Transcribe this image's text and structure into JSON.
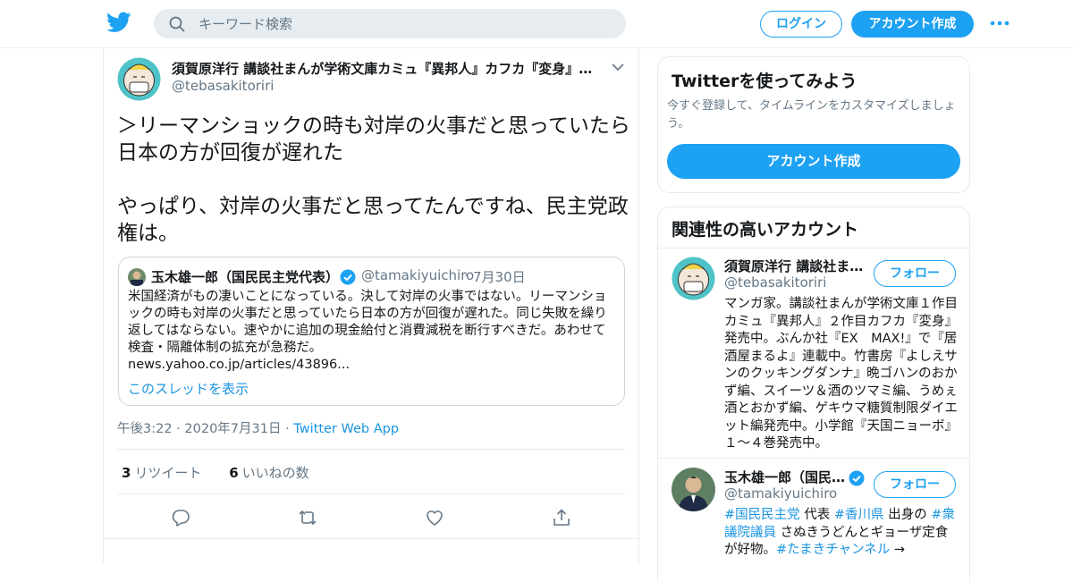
{
  "header": {
    "search_placeholder": "キーワード検索",
    "login_label": "ログイン",
    "signup_label": "アカウント作成",
    "brand_color": "#1da1f2"
  },
  "tweet": {
    "author_name": "須賀原洋行 講談社まんが学術文庫カミュ『異邦人』カフカ『変身』…",
    "author_handle": "@tebasakitoriri",
    "text_line1": "＞リーマンショックの時も対岸の火事だと思っていたら日本の方が回復が遅れた",
    "text_line2": "やっぱり、対岸の火事だと思ってたんですね、民主党政権は。",
    "quote": {
      "name": "玉木雄一郎（国民民主党代表）",
      "handle": "@tamakiyuichiro",
      "dot": "·",
      "date": "7月30日",
      "text": "米国経済がもの凄いことになっている。決して対岸の火事ではない。リーマンショックの時も対岸の火事だと思っていたら日本の方が回復が遅れた。同じ失敗を繰り返してはならない。速やかに追加の現金給付と消費減税を断行すべきだ。あわせて検査・隔離体制の拡充が急務だ。",
      "link": "news.yahoo.co.jp/articles/43896...",
      "thread_label": "このスレッドを表示"
    },
    "time": "午後3:22",
    "sep1": " · ",
    "date": "2020年7月31日",
    "sep2": " · ",
    "via": "Twitter Web App",
    "retweets_count": "3",
    "retweets_label": "リツイート",
    "likes_count": "6",
    "likes_label": "いいねの数"
  },
  "sidebar": {
    "try_card": {
      "title": "Twitterを使ってみよう",
      "desc": "今すぐ登録して、タイムラインをカスタマイズしましょう。",
      "cta": "アカウント作成"
    },
    "related": {
      "title": "関連性の高いアカウント",
      "accounts": [
        {
          "name": "須賀原洋行 講談社ま…",
          "handle": "@tebasakitoriri",
          "follow_label": "フォロー",
          "bio": "マンガ家。講談社まんが学術文庫１作目カミュ『異邦人』２作目カフカ『変身』発売中。ぶんか社『EX　MAX!』で『居酒屋まるよ』連載中。竹書房『よしえサンのクッキングダンナ』晩ゴハンのおかず編、スイーツ＆酒のツマミ編、うめぇ酒とおかず編、ゲキウマ糖質制限ダイエット編発売中。小学館『天国ニョーボ』１〜４巻発売中。"
        },
        {
          "name": "玉木雄一郎（国民…",
          "handle": "@tamakiyuichiro",
          "follow_label": "フォロー",
          "bio_tag1": "#国民民主党",
          "bio_t1": " 代表 ",
          "bio_tag2": "#香川県",
          "bio_t2": " 出身の ",
          "bio_tag3": "#衆議院議員",
          "bio_t3": " さぬきうどんとギョーザ定食が好物。",
          "bio_tag4": "#たまきチャンネル",
          "bio_t4": " →"
        }
      ]
    }
  }
}
